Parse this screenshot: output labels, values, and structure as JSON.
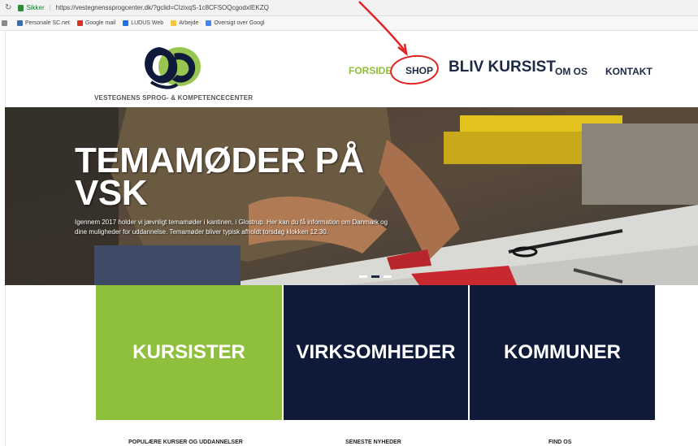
{
  "browser": {
    "secure_label": "Sikker",
    "url": "https://vestegnenssprogcenter.dk/?gclid=CIzixqS-1c8CFSOQcgodxIEKZQ",
    "bookmarks": [
      {
        "label": "Personale SC.net",
        "color": "#3b6db3"
      },
      {
        "label": "Google mail",
        "color": "#d93025"
      },
      {
        "label": "LUDUS Web",
        "color": "#1a73e8"
      },
      {
        "label": "Arbejde",
        "color": "#f4c542"
      },
      {
        "label": "Oversigt over Googl",
        "color": "#4285f4"
      }
    ]
  },
  "header": {
    "logo_text": "VESTEGNENS SPROG- & KOMPETENCECENTER",
    "nav": {
      "forside": "FORSIDE",
      "shop": "SHOP",
      "bliv_kursist": "BLIV KURSIST",
      "om_os": "OM OS",
      "kontakt": "KONTAKT"
    }
  },
  "hero": {
    "title_line1": "TEMAMØDER PÅ",
    "title_line2": "VSK",
    "text": "Igennem 2017 holder vi jævnligt temamøder i kantinen, i Glostrup. Her kan du få information om Danmark og dine muligheder for uddannelse. Temamøder bliver typisk afholdt torsdag klokken 12:30."
  },
  "tiles": {
    "kursister": "KURSISTER",
    "virksomheder": "VIRKSOMHEDER",
    "kommuner": "KOMMUNER"
  },
  "footer_headings": {
    "col1": "POPULÆRE KURSER OG UDDANNELSER",
    "col2": "SENESTE NYHEDER",
    "col3": "FIND OS"
  },
  "colors": {
    "accent_green": "#8ec03d",
    "navy": "#0f1a3a",
    "annotation_red": "#e12424"
  }
}
